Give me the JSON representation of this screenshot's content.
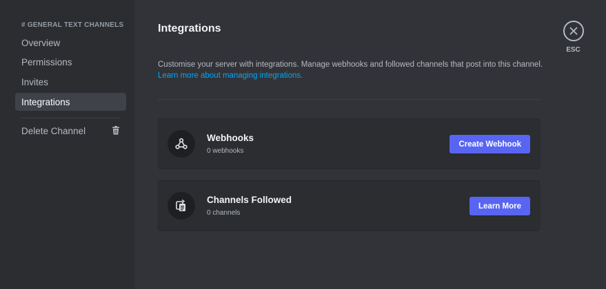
{
  "sidebar": {
    "header": "# GENERAL TEXT CHANNELS",
    "items": [
      {
        "label": "Overview"
      },
      {
        "label": "Permissions"
      },
      {
        "label": "Invites"
      },
      {
        "label": "Integrations",
        "active": true
      }
    ],
    "delete_label": "Delete Channel"
  },
  "main": {
    "title": "Integrations",
    "description": "Customise your server with integrations. Manage webhooks and followed channels that post into this channel.",
    "link": "Learn more about managing integrations.",
    "cards": [
      {
        "icon": "webhook-icon",
        "title": "Webhooks",
        "subtitle": "0 webhooks",
        "button": "Create Webhook"
      },
      {
        "icon": "channels-followed-icon",
        "title": "Channels Followed",
        "subtitle": "0 channels",
        "button": "Learn More"
      }
    ]
  },
  "close": {
    "icon": "close-icon",
    "label": "ESC"
  },
  "colors": {
    "accent": "#5865f2",
    "link": "#00a8fc",
    "sidebar_bg": "#2b2d31",
    "main_bg": "#313338"
  }
}
